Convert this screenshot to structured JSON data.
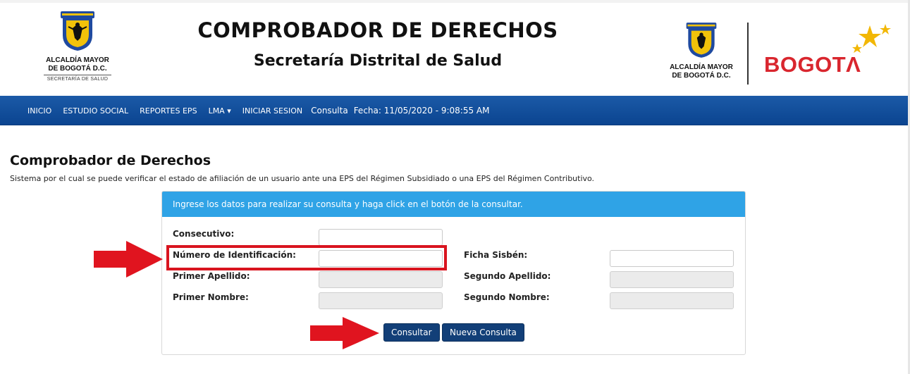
{
  "header": {
    "title": "COMPROBADOR DE DERECHOS",
    "subtitle": "Secretaría Distrital de Salud",
    "logo_left": {
      "line1": "ALCALDÍA MAYOR",
      "line2": "DE BOGOTÁ D.C.",
      "line3": "SECRETARÍA DE SALUD"
    },
    "logo_right": {
      "line1": "ALCALDÍA MAYOR",
      "line2": "DE BOGOTÁ D.C."
    },
    "brand": "BOGOTΛ"
  },
  "nav": {
    "items": [
      "INICIO",
      "ESTUDIO SOCIAL",
      "REPORTES EPS",
      "LMA",
      "INICIAR SESION"
    ],
    "consulta_label": "Consulta",
    "fecha": "Fecha: 11/05/2020 - 9:08:55 AM"
  },
  "page": {
    "title": "Comprobador de Derechos",
    "description": "Sistema por el cual se puede verificar el estado de afiliación de un usuario ante una EPS del Régimen Subsidiado o una EPS del Régimen Contributivo."
  },
  "form": {
    "instructions": "Ingrese los datos para realizar su consulta y haga click en el botón de la consultar.",
    "consecutivo_label": "Consecutivo:",
    "consecutivo_value": "",
    "numero_id_label": "Número de Identificación:",
    "numero_id_value": "",
    "ficha_sisben_label": "Ficha Sisbén:",
    "ficha_sisben_value": "",
    "primer_apellido_label": "Primer Apellido:",
    "segundo_apellido_label": "Segundo Apellido:",
    "primer_nombre_label": "Primer Nombre:",
    "segundo_nombre_label": "Segundo Nombre:",
    "consultar_label": "Consultar",
    "nueva_consulta_label": "Nueva Consulta"
  },
  "colors": {
    "nav_blue": "#0b4490",
    "panel_header": "#2fa3e6",
    "button": "#123f78",
    "annotation_red": "#d9141f",
    "brand_red": "#d9262e",
    "star_gold": "#f2b705"
  },
  "icons": {
    "coat_of_arms": "bogota-coat-of-arms-icon",
    "caret": "caret-down-icon",
    "arrow": "red-right-arrow-icon",
    "stars": "gold-stars-icon"
  }
}
